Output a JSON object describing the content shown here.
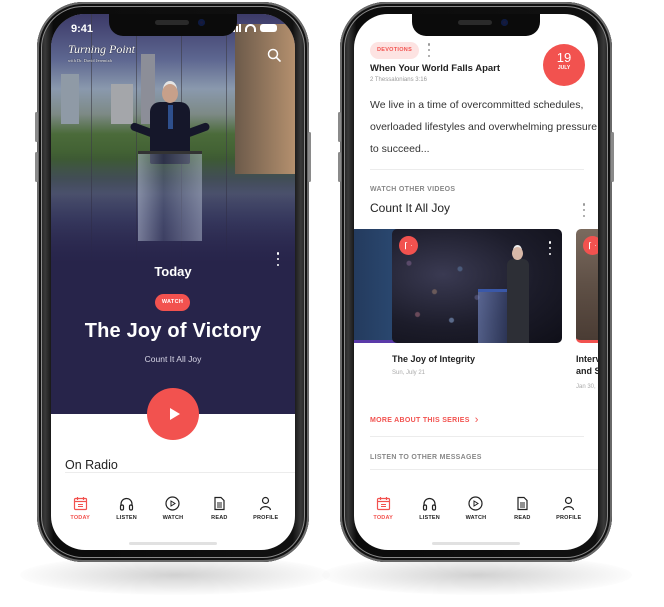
{
  "colors": {
    "accent": "#f2524f",
    "hero_bg": "#27244a",
    "accent_light": "#fde3e2"
  },
  "left_phone": {
    "status_bar": {
      "time": "9:41",
      "icons": [
        "signal-icon",
        "wifi-icon",
        "battery-icon"
      ]
    },
    "header": {
      "logo_text": "Turning Point",
      "logo_tagline": "with Dr. David Jeremiah",
      "search_icon": "search-icon"
    },
    "hero": {
      "section_label": "Today",
      "badge": "WATCH",
      "title": "The Joy of Victory",
      "subtitle": "Count It All Joy",
      "play_icon": "play-icon"
    },
    "radio": {
      "title": "On Radio"
    }
  },
  "right_phone": {
    "devotion": {
      "badge": "DEVOTIONS",
      "title": "When Your World Falls Apart",
      "reference": "2 Thessalonians 3:16",
      "body": "We live in a time of overcommitted schedules, overloaded lifestyles and overwhelming pressure to succeed...",
      "date": {
        "day": "19",
        "month": "JULY"
      }
    },
    "videos": {
      "section_label": "WATCH OTHER VIDEOS",
      "series_title": "Count It All Joy",
      "cards": [
        {
          "title": "",
          "date": ""
        },
        {
          "title": "The Joy of Integrity",
          "date": "Sun, July 21"
        },
        {
          "title": "Interv… and S…",
          "title_line1": "Interv",
          "title_line2": "and S",
          "date": "Jan 30,"
        }
      ],
      "more_link": "MORE ABOUT THIS SERIES"
    },
    "messages": {
      "section_label": "LISTEN TO OTHER MESSAGES"
    }
  },
  "tab_bar": {
    "items": [
      {
        "label": "TODAY",
        "icon": "calendar-icon",
        "active": true
      },
      {
        "label": "LISTEN",
        "icon": "headphones-icon",
        "active": false
      },
      {
        "label": "WATCH",
        "icon": "play-circle-icon",
        "active": false
      },
      {
        "label": "READ",
        "icon": "document-icon",
        "active": false
      },
      {
        "label": "PROFILE",
        "icon": "user-icon",
        "active": false
      }
    ]
  }
}
